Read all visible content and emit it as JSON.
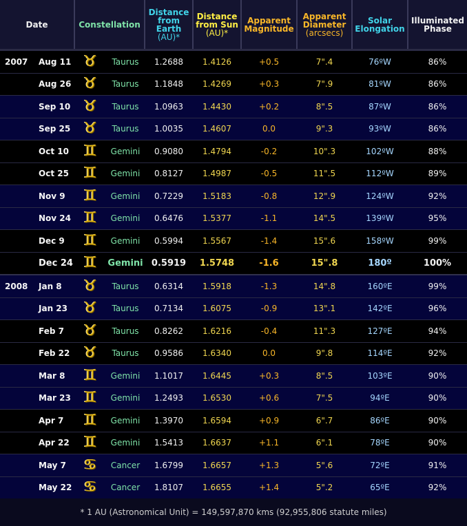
{
  "headers": {
    "date": "Date",
    "constellation": "Constellation",
    "dist_earth": [
      "Distance",
      "from",
      "Earth"
    ],
    "dist_earth_unit": "(AU)*",
    "dist_sun": [
      "Distance",
      "from Sun"
    ],
    "dist_sun_unit": "(AU)*",
    "magnitude": [
      "Apparent",
      "Magnitude"
    ],
    "diameter": [
      "Apparent",
      "Diameter"
    ],
    "diameter_unit": "(arcsecs)",
    "elongation": [
      "Solar",
      "Elongation"
    ],
    "phase": [
      "Illuminated",
      "Phase"
    ]
  },
  "colors": {
    "symbol": "#e2b615",
    "header_cyan": "#41d3e8",
    "header_yellow": "#ffee44",
    "header_orange": "#f8b628",
    "row_dark": "#000000",
    "row_blue": "#04043a"
  },
  "rows": [
    {
      "year": "2007",
      "date": "Aug 11",
      "symbol": "♉",
      "symbol_icon": "taurus-icon",
      "constellation": "Taurus",
      "dist_earth": "1.2688",
      "dist_sun": "1.4126",
      "magnitude": "+0.5",
      "diameter": "7\".4",
      "elongation": "76ºW",
      "phase": "86%"
    },
    {
      "year": "",
      "date": "Aug 26",
      "symbol": "♉",
      "symbol_icon": "taurus-icon",
      "constellation": "Taurus",
      "dist_earth": "1.1848",
      "dist_sun": "1.4269",
      "magnitude": "+0.3",
      "diameter": "7\".9",
      "elongation": "81ºW",
      "phase": "86%"
    },
    {
      "year": "",
      "date": "Sep 10",
      "symbol": "♉",
      "symbol_icon": "taurus-icon",
      "constellation": "Taurus",
      "dist_earth": "1.0963",
      "dist_sun": "1.4430",
      "magnitude": "+0.2",
      "diameter": "8\".5",
      "elongation": "87ºW",
      "phase": "86%"
    },
    {
      "year": "",
      "date": "Sep 25",
      "symbol": "♉",
      "symbol_icon": "taurus-icon",
      "constellation": "Taurus",
      "dist_earth": "1.0035",
      "dist_sun": "1.4607",
      "magnitude": "0.0",
      "diameter": "9\".3",
      "elongation": "93ºW",
      "phase": "86%"
    },
    {
      "year": "",
      "date": "Oct 10",
      "symbol": "♊",
      "symbol_icon": "gemini-icon",
      "constellation": "Gemini",
      "dist_earth": "0.9080",
      "dist_sun": "1.4794",
      "magnitude": "-0.2",
      "diameter": "10\".3",
      "elongation": "102ºW",
      "phase": "88%"
    },
    {
      "year": "",
      "date": "Oct 25",
      "symbol": "♊",
      "symbol_icon": "gemini-icon",
      "constellation": "Gemini",
      "dist_earth": "0.8127",
      "dist_sun": "1.4987",
      "magnitude": "-0.5",
      "diameter": "11\".5",
      "elongation": "112ºW",
      "phase": "89%"
    },
    {
      "year": "",
      "date": "Nov 9",
      "symbol": "♊",
      "symbol_icon": "gemini-icon",
      "constellation": "Gemini",
      "dist_earth": "0.7229",
      "dist_sun": "1.5183",
      "magnitude": "-0.8",
      "diameter": "12\".9",
      "elongation": "124ºW",
      "phase": "92%"
    },
    {
      "year": "",
      "date": "Nov 24",
      "symbol": "♊",
      "symbol_icon": "gemini-icon",
      "constellation": "Gemini",
      "dist_earth": "0.6476",
      "dist_sun": "1.5377",
      "magnitude": "-1.1",
      "diameter": "14\".5",
      "elongation": "139ºW",
      "phase": "95%"
    },
    {
      "year": "",
      "date": "Dec 9",
      "symbol": "♊",
      "symbol_icon": "gemini-icon",
      "constellation": "Gemini",
      "dist_earth": "0.5994",
      "dist_sun": "1.5567",
      "magnitude": "-1.4",
      "diameter": "15\".6",
      "elongation": "158ºW",
      "phase": "99%"
    },
    {
      "year": "",
      "date": "Dec 24",
      "symbol": "♊",
      "symbol_icon": "gemini-icon",
      "constellation": "Gemini",
      "dist_earth": "0.5919",
      "dist_sun": "1.5748",
      "magnitude": "-1.6",
      "diameter": "15\".8",
      "elongation": "180º",
      "phase": "100%",
      "highlight": true
    },
    {
      "year": "2008",
      "date": "Jan 8",
      "symbol": "♉",
      "symbol_icon": "taurus-icon",
      "constellation": "Taurus",
      "dist_earth": "0.6314",
      "dist_sun": "1.5918",
      "magnitude": "-1.3",
      "diameter": "14\".8",
      "elongation": "160ºE",
      "phase": "99%"
    },
    {
      "year": "",
      "date": "Jan 23",
      "symbol": "♉",
      "symbol_icon": "taurus-icon",
      "constellation": "Taurus",
      "dist_earth": "0.7134",
      "dist_sun": "1.6075",
      "magnitude": "-0.9",
      "diameter": "13\".1",
      "elongation": "142ºE",
      "phase": "96%"
    },
    {
      "year": "",
      "date": "Feb 7",
      "symbol": "♉",
      "symbol_icon": "taurus-icon",
      "constellation": "Taurus",
      "dist_earth": "0.8262",
      "dist_sun": "1.6216",
      "magnitude": "-0.4",
      "diameter": "11\".3",
      "elongation": "127ºE",
      "phase": "94%"
    },
    {
      "year": "",
      "date": "Feb 22",
      "symbol": "♉",
      "symbol_icon": "taurus-icon",
      "constellation": "Taurus",
      "dist_earth": "0.9586",
      "dist_sun": "1.6340",
      "magnitude": "0.0",
      "diameter": "9\".8",
      "elongation": "114ºE",
      "phase": "92%"
    },
    {
      "year": "",
      "date": "Mar 8",
      "symbol": "♊",
      "symbol_icon": "gemini-icon",
      "constellation": "Gemini",
      "dist_earth": "1.1017",
      "dist_sun": "1.6445",
      "magnitude": "+0.3",
      "diameter": "8\".5",
      "elongation": "103ºE",
      "phase": "90%"
    },
    {
      "year": "",
      "date": "Mar 23",
      "symbol": "♊",
      "symbol_icon": "gemini-icon",
      "constellation": "Gemini",
      "dist_earth": "1.2493",
      "dist_sun": "1.6530",
      "magnitude": "+0.6",
      "diameter": "7\".5",
      "elongation": "94ºE",
      "phase": "90%"
    },
    {
      "year": "",
      "date": "Apr 7",
      "symbol": "♊",
      "symbol_icon": "gemini-icon",
      "constellation": "Gemini",
      "dist_earth": "1.3970",
      "dist_sun": "1.6594",
      "magnitude": "+0.9",
      "diameter": "6\".7",
      "elongation": "86ºE",
      "phase": "90%"
    },
    {
      "year": "",
      "date": "Apr 22",
      "symbol": "♊",
      "symbol_icon": "gemini-icon",
      "constellation": "Gemini",
      "dist_earth": "1.5413",
      "dist_sun": "1.6637",
      "magnitude": "+1.1",
      "diameter": "6\".1",
      "elongation": "78ºE",
      "phase": "90%"
    },
    {
      "year": "",
      "date": "May 7",
      "symbol": "♋",
      "symbol_icon": "cancer-icon",
      "constellation": "Cancer",
      "dist_earth": "1.6799",
      "dist_sun": "1.6657",
      "magnitude": "+1.3",
      "diameter": "5\".6",
      "elongation": "72ºE",
      "phase": "91%"
    },
    {
      "year": "",
      "date": "May 22",
      "symbol": "♋",
      "symbol_icon": "cancer-icon",
      "constellation": "Cancer",
      "dist_earth": "1.8107",
      "dist_sun": "1.6655",
      "magnitude": "+1.4",
      "diameter": "5\".2",
      "elongation": "65ºE",
      "phase": "92%"
    }
  ],
  "footer": "* 1 AU (Astronomical Unit) = 149,597,870 kms (92,955,806 statute miles)"
}
